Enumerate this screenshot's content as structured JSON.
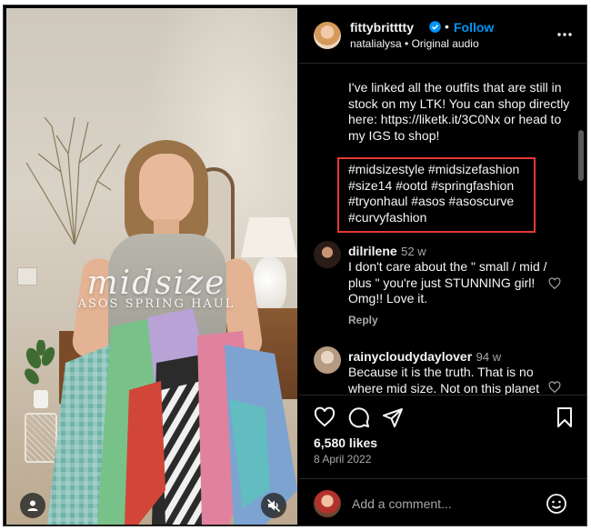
{
  "post": {
    "overlay": {
      "title": "midsize",
      "subtitle": "ASOS SPRING HAUL"
    },
    "author": {
      "username": "fittybritttty",
      "follow_label": "Follow",
      "separator": "•"
    },
    "audio": {
      "text": "natalialysa • Original audio"
    },
    "caption": "I've linked all the outfits that are still in stock on my LTK! You can shop directly here: https://liketk.it/3C0Nx or head to my IGS to shop!",
    "hashtags": "#midsizestyle #midsizefashion #size14 #ootd #springfashion #tryonhaul #asos #asoscurve #curvyfashion",
    "comments": [
      {
        "username": "dilrilene",
        "time": "52 w",
        "text": "I don't care about the \" small / mid / plus \" you're just STUNNING girl! Omg!! Love it.",
        "reply_label": "Reply"
      },
      {
        "username": "rainycloudydaylover",
        "time": "94 w",
        "text": "Because it is the truth. That is no where mid size. Not on this planet"
      }
    ],
    "likes": "6,580 likes",
    "date": "8 April 2022",
    "add_comment": {
      "placeholder": "Add a comment..."
    }
  },
  "colors": {
    "background": "#000000",
    "text": "#f5f5f5",
    "secondary_text": "#a8a8a8",
    "link_blue": "#0095f6",
    "highlight_box": "#e53935"
  },
  "icons": [
    "verified-badge-icon",
    "more-options-icon",
    "heart-icon",
    "comment-icon",
    "share-icon",
    "bookmark-icon",
    "smiley-icon",
    "user-tag-icon",
    "muted-speaker-icon"
  ]
}
